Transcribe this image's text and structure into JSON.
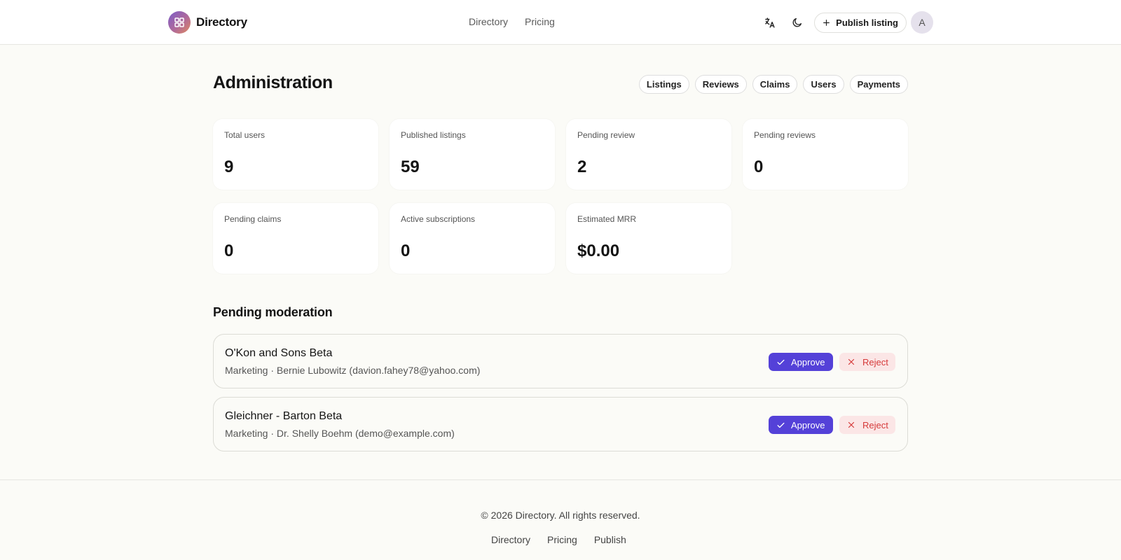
{
  "header": {
    "brand_name": "Directory",
    "nav": [
      "Directory",
      "Pricing"
    ],
    "publish_label": "Publish listing",
    "avatar_initial": "A"
  },
  "main": {
    "title": "Administration",
    "tabs": [
      "Listings",
      "Reviews",
      "Claims",
      "Users",
      "Payments"
    ],
    "stats": [
      {
        "label": "Total users",
        "value": "9"
      },
      {
        "label": "Published listings",
        "value": "59"
      },
      {
        "label": "Pending review",
        "value": "2"
      },
      {
        "label": "Pending reviews",
        "value": "0"
      },
      {
        "label": "Pending claims",
        "value": "0"
      },
      {
        "label": "Active subscriptions",
        "value": "0"
      },
      {
        "label": "Estimated MRR",
        "value": "$0.00"
      }
    ],
    "moderation_title": "Pending moderation",
    "moderation_items": [
      {
        "name": "O'Kon and Sons Beta",
        "meta": "Marketing · Bernie Lubowitz (davion.fahey78@yahoo.com)"
      },
      {
        "name": "Gleichner - Barton Beta",
        "meta": "Marketing · Dr. Shelly Boehm (demo@example.com)"
      }
    ],
    "approve_label": "Approve",
    "reject_label": "Reject"
  },
  "footer": {
    "copyright": "© 2026 Directory. All rights reserved.",
    "nav": [
      "Directory",
      "Pricing",
      "Publish"
    ]
  },
  "colors": {
    "accent": "#5441d8",
    "reject_text": "#d63b3b",
    "reject_bg": "#fbe6e6",
    "page_bg": "#fbfbf7"
  },
  "icons": {
    "brand": "grid-icon",
    "language": "translate-icon",
    "theme": "moon-icon",
    "publish": "plus-icon",
    "approve": "check-icon",
    "reject": "x-icon"
  }
}
